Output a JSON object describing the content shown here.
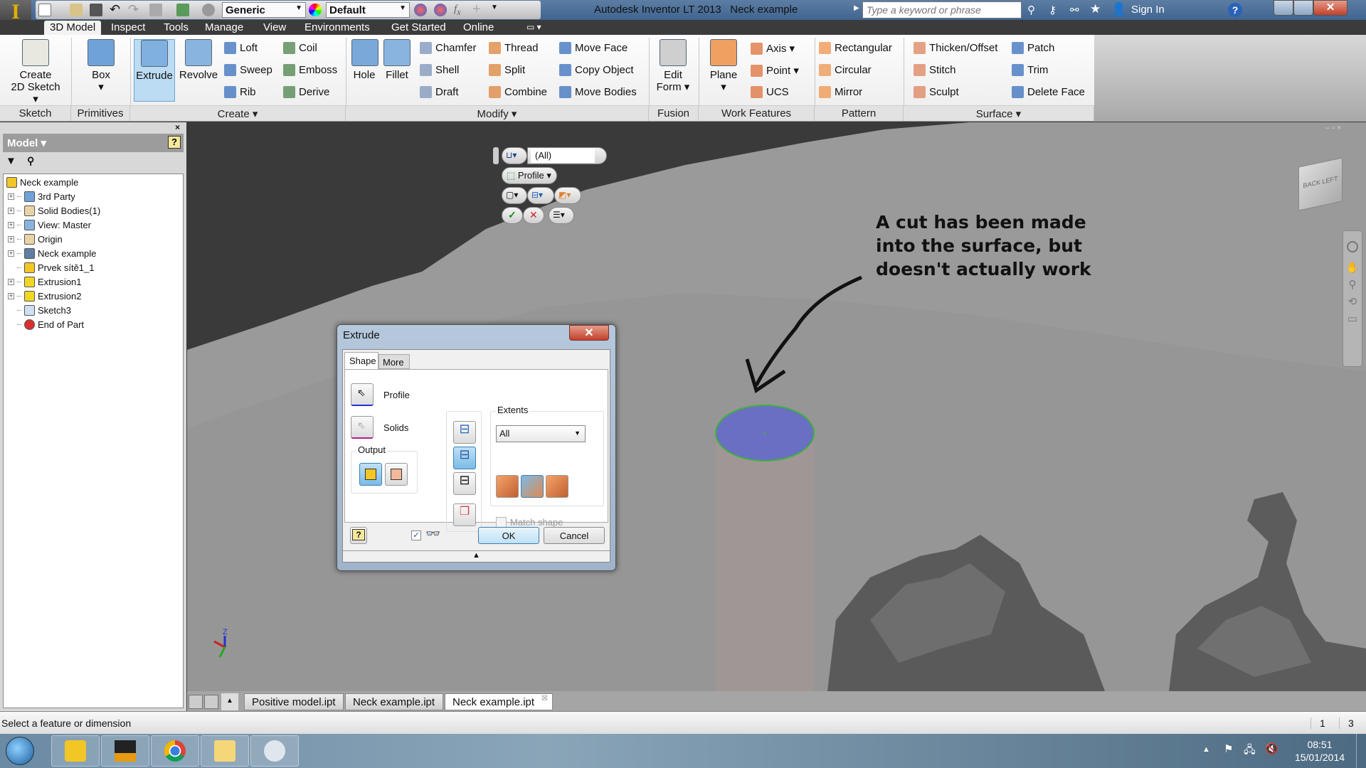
{
  "window": {
    "title": "Autodesk Inventor LT 2013",
    "document": "Neck example",
    "search_placeholder": "Type a keyword or phrase",
    "sign_in": "Sign In"
  },
  "qat": {
    "material": "Generic",
    "appearance": "Default"
  },
  "ribbon_tabs": [
    {
      "label": "3D Model",
      "active": true
    },
    {
      "label": "Inspect"
    },
    {
      "label": "Tools"
    },
    {
      "label": "Manage"
    },
    {
      "label": "View"
    },
    {
      "label": "Environments"
    },
    {
      "label": "Get Started"
    },
    {
      "label": "Online"
    }
  ],
  "ribbon_groups": [
    "Sketch",
    "Primitives",
    "Create ▾",
    "Modify ▾",
    "Fusion",
    "Work Features",
    "Pattern",
    "Surface ▾"
  ],
  "ribbon_big": [
    {
      "label": "Create\n2D Sketch ▾",
      "icon": "sketch-icon"
    },
    {
      "label": "Box\n▾",
      "icon": "box-icon"
    },
    {
      "label": "Extrude",
      "icon": "extrude-icon",
      "active": true
    },
    {
      "label": "Revolve",
      "icon": "revolve-icon"
    },
    {
      "label": "Hole",
      "icon": "hole-icon"
    },
    {
      "label": "Fillet",
      "icon": "fillet-icon"
    },
    {
      "label": "Edit\nForm ▾",
      "icon": "edit-form-icon"
    },
    {
      "label": "Plane\n▾",
      "icon": "plane-icon"
    }
  ],
  "ribbon_small": [
    {
      "label": "Loft",
      "icon": "loft-icon"
    },
    {
      "label": "Sweep",
      "icon": "sweep-icon"
    },
    {
      "label": "Rib",
      "icon": "rib-icon"
    },
    {
      "label": "Coil",
      "icon": "coil-icon"
    },
    {
      "label": "Emboss",
      "icon": "emboss-icon"
    },
    {
      "label": "Derive",
      "icon": "derive-icon"
    },
    {
      "label": "Chamfer",
      "icon": "chamfer-icon"
    },
    {
      "label": "Shell",
      "icon": "shell-icon"
    },
    {
      "label": "Draft",
      "icon": "draft-icon"
    },
    {
      "label": "Thread",
      "icon": "thread-icon"
    },
    {
      "label": "Split",
      "icon": "split-icon"
    },
    {
      "label": "Combine",
      "icon": "combine-icon"
    },
    {
      "label": "Move Face",
      "icon": "move-face-icon"
    },
    {
      "label": "Copy Object",
      "icon": "copy-object-icon"
    },
    {
      "label": "Move Bodies",
      "icon": "move-bodies-icon"
    },
    {
      "label": "Axis ▾",
      "icon": "axis-icon"
    },
    {
      "label": "Point ▾",
      "icon": "point-icon"
    },
    {
      "label": "UCS",
      "icon": "ucs-icon"
    },
    {
      "label": "Rectangular",
      "icon": "rectangular-pattern-icon"
    },
    {
      "label": "Circular",
      "icon": "circular-pattern-icon"
    },
    {
      "label": "Mirror",
      "icon": "mirror-icon"
    },
    {
      "label": "Thicken/Offset",
      "icon": "thicken-icon"
    },
    {
      "label": "Stitch",
      "icon": "stitch-icon"
    },
    {
      "label": "Sculpt",
      "icon": "sculpt-icon"
    },
    {
      "label": "Patch",
      "icon": "patch-icon"
    },
    {
      "label": "Trim",
      "icon": "trim-icon"
    },
    {
      "label": "Delete Face",
      "icon": "delete-face-icon"
    }
  ],
  "browser": {
    "title": "Model ▾",
    "tree": [
      {
        "label": "Neck example",
        "icon": "part-icon",
        "expandable": false,
        "root": true
      },
      {
        "label": "3rd Party",
        "icon": "third-party-icon",
        "expandable": true
      },
      {
        "label": "Solid Bodies(1)",
        "icon": "solid-bodies-icon",
        "expandable": true
      },
      {
        "label": "View: Master",
        "icon": "view-icon",
        "expandable": true
      },
      {
        "label": "Origin",
        "icon": "folder-icon",
        "expandable": true
      },
      {
        "label": "Neck example",
        "icon": "mesh-icon",
        "expandable": true
      },
      {
        "label": "Prvek sítě1_1",
        "icon": "part-icon",
        "expandable": false
      },
      {
        "label": "Extrusion1",
        "icon": "extrusion-icon",
        "expandable": true
      },
      {
        "label": "Extrusion2",
        "icon": "extrusion-icon",
        "expandable": true
      },
      {
        "label": "Sketch3",
        "icon": "sketch-icon",
        "expandable": false
      },
      {
        "label": "End of Part",
        "icon": "end-of-part-icon",
        "expandable": false
      }
    ]
  },
  "minitoolbar": {
    "filter_value": "(All)",
    "profile": "Profile"
  },
  "annotation": {
    "line1": "A cut has been made",
    "line2": "into the surface, but",
    "line3": "doesn't actually work"
  },
  "dialog": {
    "title": "Extrude",
    "tabs": [
      {
        "label": "Shape",
        "active": true
      },
      {
        "label": "More"
      }
    ],
    "profile_label": "Profile",
    "solids_label": "Solids",
    "output_label": "Output",
    "extents_label": "Extents",
    "extents_value": "All",
    "match_shape": "Match shape",
    "match_shape_checked": false,
    "preview_checked": true,
    "ok": "OK",
    "cancel": "Cancel"
  },
  "doc_tabs": [
    {
      "label": "Positive model.ipt"
    },
    {
      "label": "Neck example.ipt"
    },
    {
      "label": "Neck example.ipt",
      "active": true
    }
  ],
  "status": {
    "text": "Select a feature or dimension",
    "count1": "1",
    "count2": "3"
  },
  "taskbar": {
    "apps": [
      "windows-start-icon",
      "outlook-icon",
      "inventor-lt-icon",
      "chrome-icon",
      "explorer-icon",
      "paint-icon"
    ],
    "time": "08:51",
    "date": "15/01/2014"
  },
  "colors": {
    "accent": "#7bbbe6",
    "profile_face": "#6a6fc4",
    "profile_edge": "#3fb03f",
    "surface": "#9a9a9a"
  }
}
